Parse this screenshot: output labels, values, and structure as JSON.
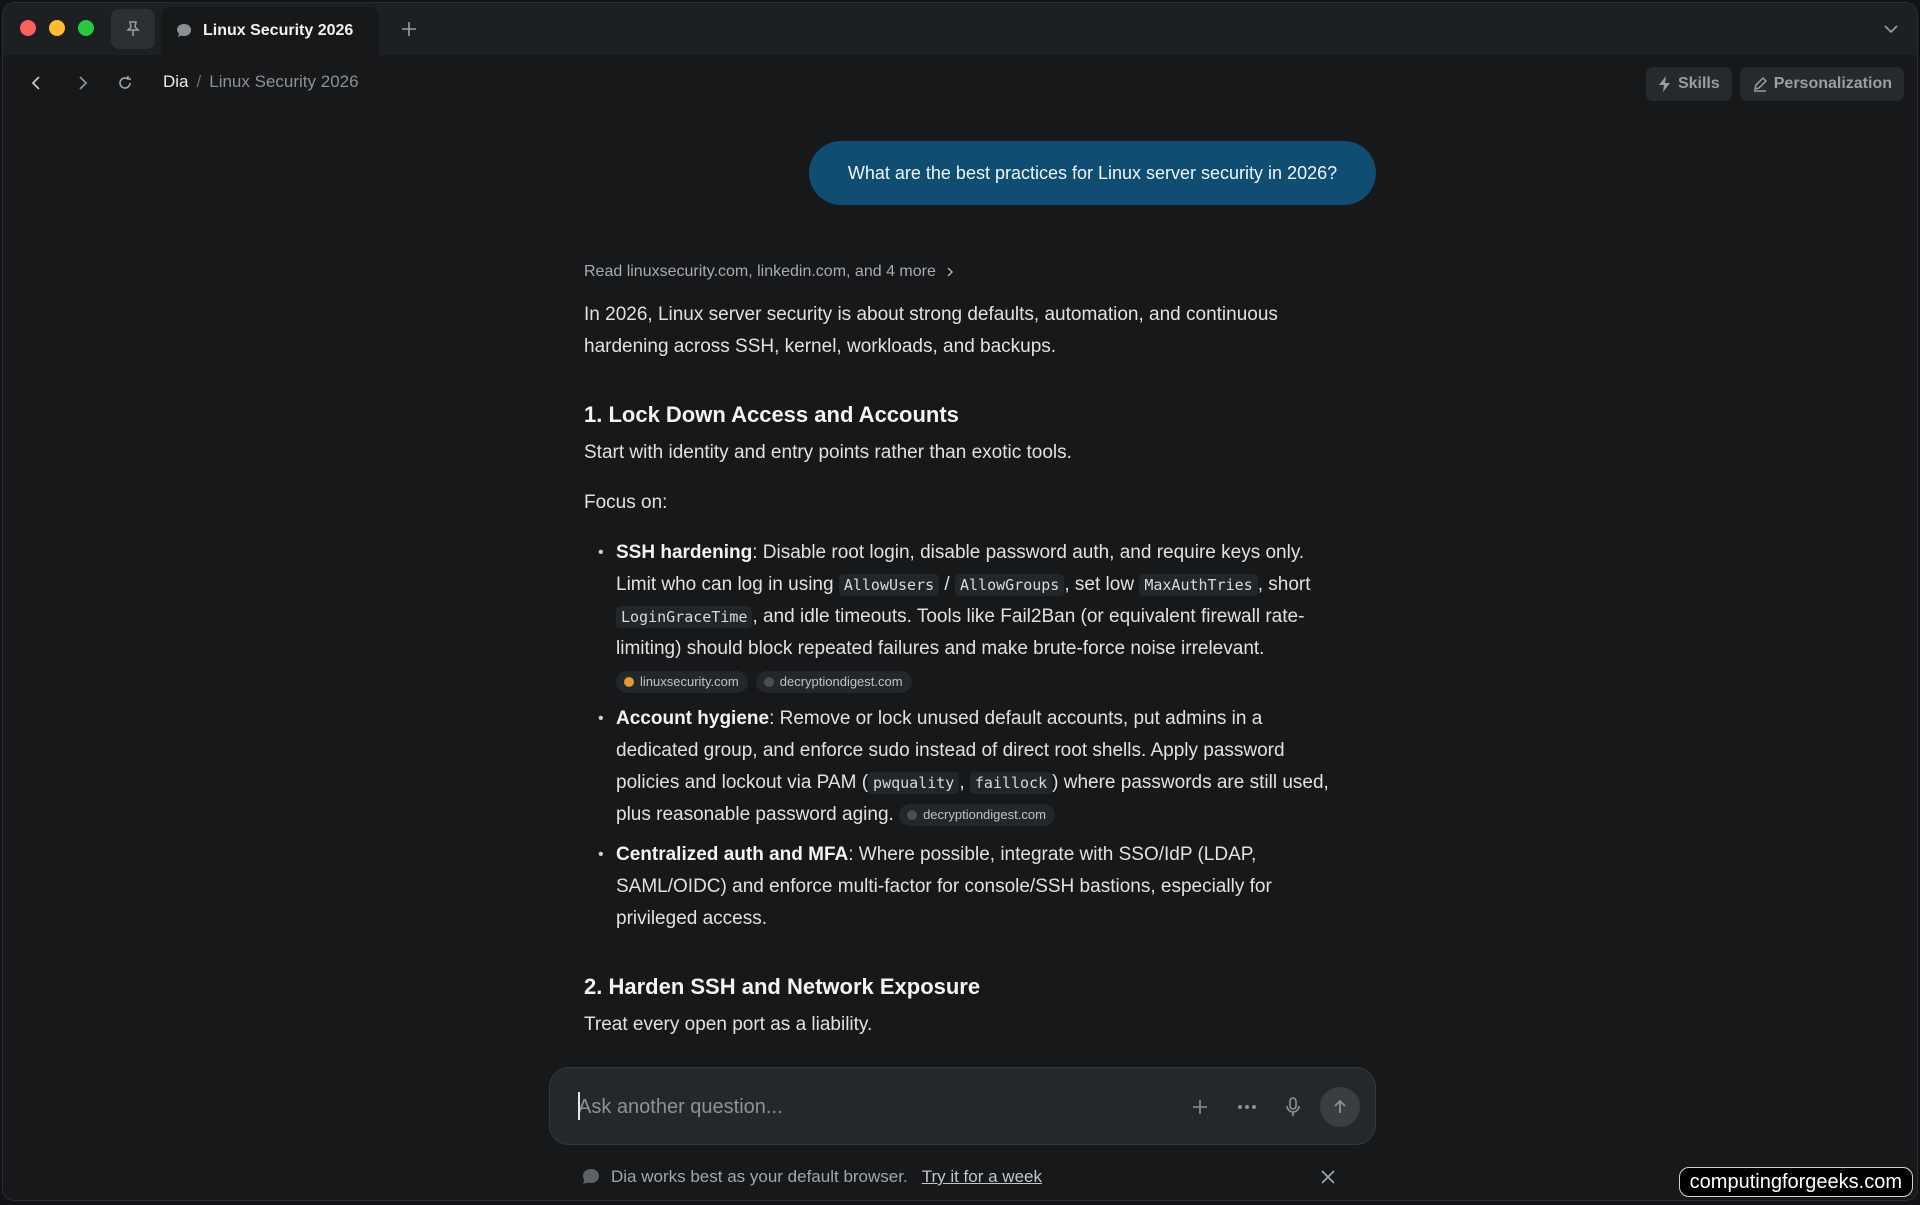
{
  "tab": {
    "title": "Linux Security 2026"
  },
  "breadcrumb": {
    "home": "Dia",
    "separator": "/",
    "current": "Linux Security 2026"
  },
  "toolbar": {
    "skills_label": "Skills",
    "personalization_label": "Personalization"
  },
  "user_message": "What are the best practices for Linux server security in 2026?",
  "answer": {
    "sources_line": "Read linuxsecurity.com, linkedin.com, and 4 more",
    "intro": "In 2026, Linux server security is about strong defaults, automation, and continuous hardening across SSH, kernel, workloads, and backups.",
    "section1": {
      "title": "1. Lock Down Access and Accounts",
      "lead": "Start with identity and entry points rather than exotic tools.",
      "focus": "Focus on:",
      "bullet1": {
        "term": "SSH hardening",
        "text1": ": Disable root login, disable password auth, and require keys only. Limit who can log in using ",
        "code1": "AllowUsers",
        "sep1": " / ",
        "code2": "AllowGroups",
        "text2": ", set low ",
        "code3": "MaxAuthTries",
        "text3": ", short ",
        "code4": "LoginGraceTime",
        "text4": ", and idle timeouts. Tools like Fail2Ban (or equivalent firewall rate-limiting) should block repeated failures and make brute-force noise irrelevant.",
        "chip1": "linuxsecurity.com",
        "chip2": "decryptiondigest.com"
      },
      "bullet2": {
        "term": "Account hygiene",
        "text1": ": Remove or lock unused default accounts, put admins in a dedicated group, and enforce sudo instead of direct root shells. Apply password policies and lockout via PAM (",
        "code1": "pwquality",
        "sep1": ", ",
        "code2": "faillock",
        "text2": ") where passwords are still used, plus reasonable password aging.",
        "chip1": "decryptiondigest.com"
      },
      "bullet3": {
        "term": "Centralized auth and MFA",
        "text1": ": Where possible, integrate with SSO/IdP (LDAP, SAML/OIDC) and enforce multi-factor for console/SSH bastions, especially for privileged access."
      }
    },
    "section2": {
      "title": "2. Harden SSH and Network Exposure",
      "lead": "Treat every open port as a liability."
    }
  },
  "composer": {
    "placeholder": "Ask another question..."
  },
  "banner": {
    "text": "Dia works best as your default browser.",
    "link": "Try it for a week"
  },
  "watermark": "computingforgeeks.com",
  "colors": {
    "accent_bubble": "#0f4d72",
    "background": "#161819"
  }
}
